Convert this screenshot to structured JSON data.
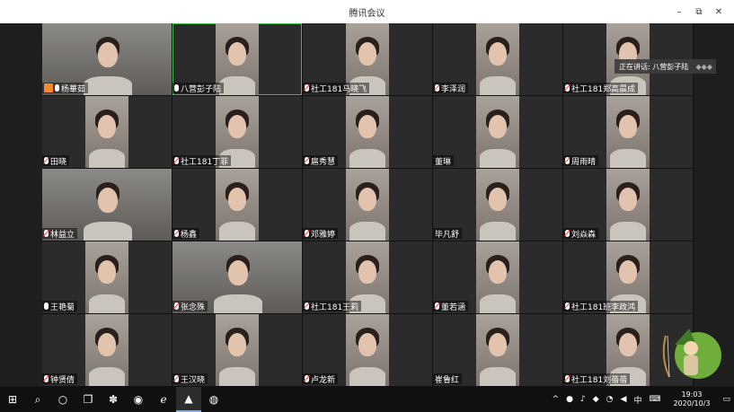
{
  "window": {
    "title": "腾讯会议",
    "controls": [
      "–",
      "⧉",
      "✕"
    ]
  },
  "speaking": {
    "label": "正在讲话: 八营彭子陆",
    "dots": "◆◆◆"
  },
  "participants": [
    {
      "name": "杨華茹",
      "mic": "on",
      "host": true
    },
    {
      "name": "八营彭子陆",
      "mic": "on",
      "active": true
    },
    {
      "name": "社工181马晓飞",
      "mic": "muted"
    },
    {
      "name": "李泽润",
      "mic": "muted"
    },
    {
      "name": "社工181郑高晨成",
      "mic": "muted"
    },
    {
      "name": "田晓",
      "mic": "muted"
    },
    {
      "name": "社工181丁菲",
      "mic": "muted"
    },
    {
      "name": "扈秀慧",
      "mic": "muted"
    },
    {
      "name": "董琳",
      "mic": "none"
    },
    {
      "name": "周雨晴",
      "mic": "muted"
    },
    {
      "name": "林益立",
      "mic": "muted"
    },
    {
      "name": "杨鑫",
      "mic": "muted"
    },
    {
      "name": "邓雅婷",
      "mic": "muted"
    },
    {
      "name": "毕凡舒",
      "mic": "none"
    },
    {
      "name": "刘焱森",
      "mic": "muted"
    },
    {
      "name": "王艳菊",
      "mic": "on"
    },
    {
      "name": "张念殊",
      "mic": "muted"
    },
    {
      "name": "社工181王莉",
      "mic": "muted"
    },
    {
      "name": "董若涵",
      "mic": "muted"
    },
    {
      "name": "社工181班李政鸿",
      "mic": "muted"
    },
    {
      "name": "钟贤倩",
      "mic": "muted"
    },
    {
      "name": "王汉晓",
      "mic": "muted"
    },
    {
      "name": "卢龙新",
      "mic": "muted"
    },
    {
      "name": "崔鲁红",
      "mic": "none"
    },
    {
      "name": "社工181刘蓓蓓",
      "mic": "muted"
    }
  ],
  "taskbar": {
    "clock_time": "19:03",
    "clock_date": "2020/10/3",
    "ime": "中",
    "tray_up": "^"
  }
}
